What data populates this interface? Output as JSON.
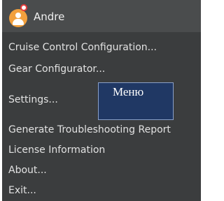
{
  "header": {
    "username": "Andre",
    "avatar_icon": "user-avatar-icon",
    "avatar_color": "#f2a03d",
    "notification_color": "#e63a3a"
  },
  "menu": {
    "items": [
      {
        "label": "Cruise Control Configuration..."
      },
      {
        "label": "Gear Configurator..."
      },
      {
        "label": "Settings..."
      },
      {
        "label": "Generate Troubleshooting Report"
      },
      {
        "label": "License Information"
      },
      {
        "label": "About..."
      },
      {
        "label": "Exit..."
      }
    ]
  },
  "overlay": {
    "text": "Меню",
    "background": "#203864"
  }
}
